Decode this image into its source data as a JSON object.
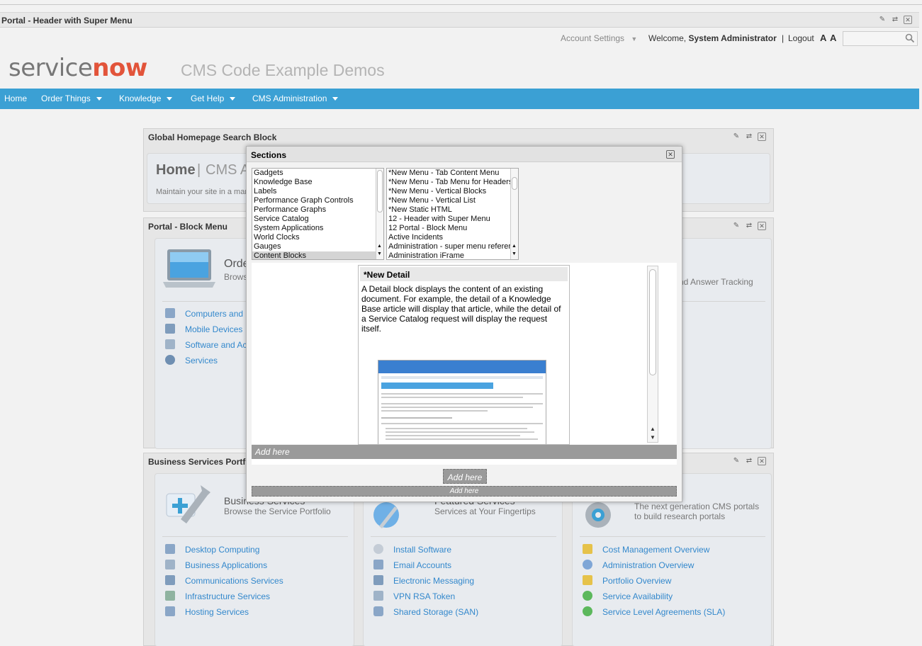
{
  "portal_header": {
    "title": "Portal - Header with Super Menu"
  },
  "account": {
    "settings_label": "Account Settings",
    "welcome_prefix": "Welcome,",
    "user": "System Administrator",
    "separator": "|",
    "logout": "Logout",
    "font_size": "A A",
    "search_placeholder": ""
  },
  "logo": {
    "service": "service",
    "now": "now"
  },
  "site_title": "CMS Code Example Demos",
  "nav": [
    {
      "label": "Home"
    },
    {
      "label": "Order Things"
    },
    {
      "label": "Knowledge"
    },
    {
      "label": "Get Help"
    },
    {
      "label": "CMS Administration"
    }
  ],
  "search_block": {
    "title": "Global Homepage Search Block",
    "home": "Home",
    "sep": "|",
    "cms": "CMS A",
    "desc": "Maintain your site in a man"
  },
  "block_menu": {
    "title": "Portal - Block Menu",
    "col1": {
      "heading": "Orde",
      "sub": "Brows",
      "links": [
        "Computers and",
        "Mobile Devices",
        "Software and Ac",
        "Services"
      ]
    },
    "col3_sub": "nd Answer Tracking"
  },
  "business": {
    "title": "Business Services Portf",
    "col1": {
      "heading": "Business Services",
      "sub": "Browse the Service Portfolio",
      "links": [
        "Desktop Computing",
        "Business Applications",
        "Communications Services",
        "Infrastructure Services",
        "Hosting Services"
      ]
    },
    "col2": {
      "heading": "Featured Services",
      "sub": "Services at Your Fingertips",
      "links": [
        "Install Software",
        "Email Accounts",
        "Electronic Messaging",
        "VPN RSA Token",
        "Shared Storage (SAN)"
      ]
    },
    "col3": {
      "sub1": "The next generation CMS portals",
      "sub2": "to build research portals",
      "links": [
        "Cost Management Overview",
        "Administration Overview",
        "Portfolio Overview",
        "Service Availability",
        "Service Level Agreements (SLA)"
      ]
    }
  },
  "modal": {
    "title": "Sections",
    "categories": [
      "Gadgets",
      "Knowledge Base",
      "Labels",
      "Performance Graph Controls",
      "Performance Graphs",
      "Service Catalog",
      "System Applications",
      "World Clocks",
      "Gauges",
      "Content Blocks"
    ],
    "selected_category": "Content Blocks",
    "items": [
      "*New Menu - Tab Content Menu",
      "*New Menu - Tab Menu for Headers",
      "*New Menu - Vertical Blocks",
      "*New Menu - Vertical List",
      "*New Static HTML",
      "12 - Header with Super Menu",
      "12 Portal - Block Menu",
      "Active Incidents",
      "Administration - super menu reference",
      "Administration iFrame"
    ],
    "detail_title": "*New Detail",
    "detail_desc": "A Detail block displays the content of an existing document. For example, the detail of a Knowledge Base article will display that article, while the detail of a Service Catalog request will display the request itself.",
    "add_here_1": "Add here",
    "add_here_2": "Add here",
    "add_here_3": "Add here"
  },
  "colors": {
    "nav": "#3ba0d4",
    "link": "#3388cc",
    "logo_now": "#e2543a"
  }
}
